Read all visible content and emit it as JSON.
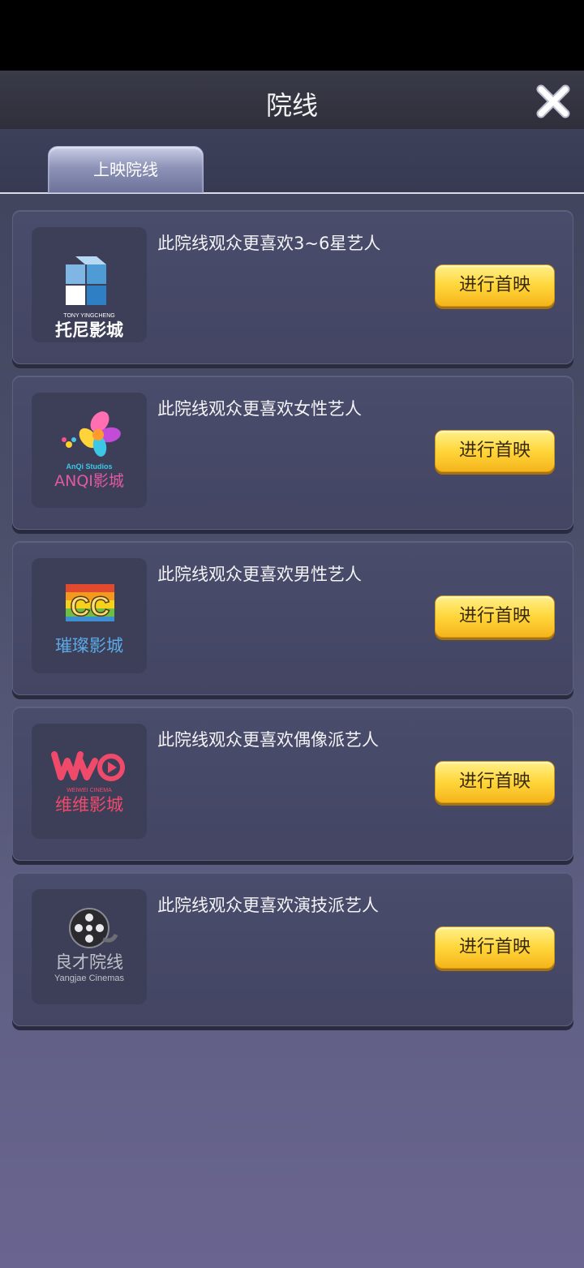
{
  "header": {
    "title": "院线"
  },
  "tabs": [
    {
      "label": "上映院线"
    }
  ],
  "cinemas": [
    {
      "logo": {
        "icon": "cube-logo-icon",
        "text_top": "TONY  YINGCHENG",
        "text_main": "托尼影城"
      },
      "description": "此院线观众更喜欢3~6星艺人",
      "button": "进行首映"
    },
    {
      "logo": {
        "icon": "star-flower-logo-icon",
        "text_top": "AnQi  Studios",
        "text_main": "ANQI影城"
      },
      "description": "此院线观众更喜欢女性艺人",
      "button": "进行首映"
    },
    {
      "logo": {
        "icon": "cc-logo-icon",
        "text_top": "CC",
        "text_main": "璀璨影城"
      },
      "description": "此院线观众更喜欢男性艺人",
      "button": "进行首映"
    },
    {
      "logo": {
        "icon": "wwo-logo-icon",
        "text_top": "WEIWEI  CINEMA",
        "text_main": "维维影城"
      },
      "description": "此院线观众更喜欢偶像派艺人",
      "button": "进行首映"
    },
    {
      "logo": {
        "icon": "film-reel-logo-icon",
        "text_top": "良才院线",
        "text_main": "Yangjae Cinemas"
      },
      "description": "此院线观众更喜欢演技派艺人",
      "button": "进行首映"
    }
  ]
}
